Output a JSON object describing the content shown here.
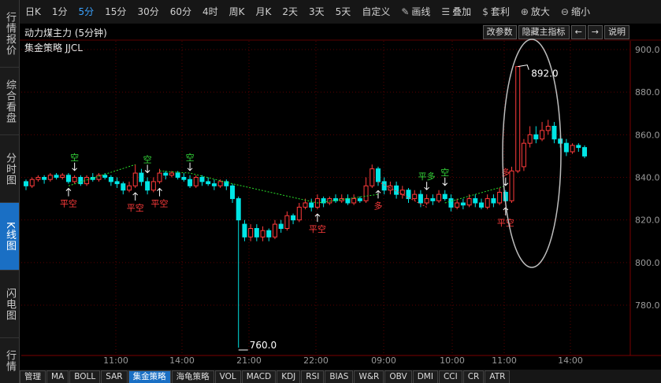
{
  "sidebar": {
    "tabs": [
      {
        "label": "行情报价"
      },
      {
        "label": "综合看盘"
      },
      {
        "label": "分时图"
      },
      {
        "label": "K线图"
      },
      {
        "label": "闪电图"
      },
      {
        "label": "行情"
      }
    ]
  },
  "toolbar": {
    "periods": [
      "日K",
      "1分",
      "5分",
      "15分",
      "30分",
      "60分",
      "4时",
      "周K",
      "月K",
      "2天",
      "3天",
      "5天",
      "自定义"
    ],
    "active_period": "5分",
    "tools": [
      {
        "label": "画线",
        "icon": "pencil-icon"
      },
      {
        "label": "叠加",
        "icon": "layers-icon"
      },
      {
        "label": "套利",
        "icon": "money-bag-icon"
      },
      {
        "label": "放大",
        "icon": "zoom-in-icon"
      },
      {
        "label": "缩小",
        "icon": "zoom-out-icon"
      }
    ]
  },
  "chart_header": {
    "title": "动力煤主力 (5分钟)",
    "buttons": {
      "params": "改参数",
      "hide_main": "隐藏主指标",
      "left": "←",
      "right": "→",
      "help": "说明"
    },
    "indicator": "集金策略 JJCL"
  },
  "colors": {
    "up": "#ff3b3b",
    "down": "#00e5e5",
    "signal_line": "#2adf2a",
    "grid": "#5a0000",
    "accent": "#1a6fc4"
  },
  "chart_data": {
    "type": "candlestick",
    "ylim": [
      765,
      905
    ],
    "y_ticks": [
      "900.0",
      "880.0",
      "860.0",
      "840.0",
      "820.0",
      "800.0",
      "780.0"
    ],
    "x_ticks": [
      "11:00",
      "14:00",
      "21:00",
      "22:00",
      "09:00",
      "10:00",
      "11:00",
      "14:00"
    ],
    "annotations": [
      {
        "text": "892.0",
        "value": 892.0
      },
      {
        "text": "760.0",
        "value": 760.0
      }
    ],
    "candles": [
      [
        838,
        836,
        839,
        834
      ],
      [
        836,
        839,
        840,
        835
      ],
      [
        839,
        840,
        841,
        838
      ],
      [
        840,
        839,
        841,
        837
      ],
      [
        839,
        841,
        842,
        838
      ],
      [
        841,
        840,
        842,
        839
      ],
      [
        840,
        841,
        842,
        839
      ],
      [
        841,
        838,
        842,
        837
      ],
      [
        838,
        840,
        841,
        837
      ],
      [
        840,
        837,
        841,
        836
      ],
      [
        837,
        840,
        841,
        836
      ],
      [
        840,
        839,
        842,
        838
      ],
      [
        839,
        841,
        842,
        838
      ],
      [
        841,
        840,
        842,
        839
      ],
      [
        840,
        838,
        841,
        836
      ],
      [
        838,
        837,
        840,
        835
      ],
      [
        837,
        834,
        838,
        832
      ],
      [
        834,
        836,
        838,
        833
      ],
      [
        836,
        842,
        846,
        835
      ],
      [
        842,
        838,
        844,
        836
      ],
      [
        838,
        834,
        840,
        832
      ],
      [
        834,
        838,
        840,
        833
      ],
      [
        838,
        842,
        844,
        837
      ],
      [
        842,
        841,
        843,
        839
      ],
      [
        841,
        842,
        843,
        840
      ],
      [
        842,
        840,
        843,
        839
      ],
      [
        840,
        839,
        842,
        838
      ],
      [
        839,
        836,
        841,
        835
      ],
      [
        836,
        840,
        841,
        835
      ],
      [
        840,
        838,
        841,
        836
      ],
      [
        838,
        837,
        840,
        836
      ],
      [
        837,
        836,
        839,
        834
      ],
      [
        836,
        838,
        839,
        835
      ],
      [
        838,
        836,
        839,
        834
      ],
      [
        836,
        830,
        837,
        828
      ],
      [
        830,
        820,
        831,
        760
      ],
      [
        818,
        812,
        820,
        810
      ],
      [
        812,
        816,
        818,
        810
      ],
      [
        816,
        812,
        818,
        810
      ],
      [
        812,
        815,
        817,
        810
      ],
      [
        815,
        812,
        816,
        810
      ],
      [
        812,
        818,
        820,
        811
      ],
      [
        818,
        816,
        820,
        814
      ],
      [
        816,
        822,
        824,
        815
      ],
      [
        822,
        820,
        823,
        818
      ],
      [
        820,
        826,
        828,
        819
      ],
      [
        826,
        828,
        830,
        825
      ],
      [
        828,
        826,
        830,
        824
      ],
      [
        826,
        830,
        832,
        825
      ],
      [
        830,
        828,
        831,
        826
      ],
      [
        828,
        830,
        831,
        827
      ],
      [
        830,
        829,
        832,
        828
      ],
      [
        829,
        830,
        832,
        828
      ],
      [
        830,
        828,
        832,
        827
      ],
      [
        828,
        830,
        832,
        827
      ],
      [
        830,
        829,
        831,
        828
      ],
      [
        829,
        836,
        840,
        828
      ],
      [
        836,
        844,
        846,
        835
      ],
      [
        844,
        838,
        845,
        836
      ],
      [
        838,
        834,
        840,
        832
      ],
      [
        834,
        836,
        838,
        832
      ],
      [
        836,
        832,
        838,
        830
      ],
      [
        832,
        834,
        836,
        830
      ],
      [
        834,
        830,
        835,
        828
      ],
      [
        830,
        832,
        834,
        829
      ],
      [
        832,
        828,
        834,
        826
      ],
      [
        828,
        830,
        832,
        827
      ],
      [
        830,
        829,
        832,
        827
      ],
      [
        829,
        832,
        834,
        828
      ],
      [
        832,
        830,
        834,
        829
      ],
      [
        830,
        826,
        832,
        824
      ],
      [
        826,
        828,
        830,
        825
      ],
      [
        828,
        827,
        830,
        825
      ],
      [
        827,
        830,
        832,
        826
      ],
      [
        830,
        828,
        832,
        826
      ],
      [
        828,
        826,
        830,
        825
      ],
      [
        826,
        830,
        832,
        825
      ],
      [
        830,
        828,
        832,
        826
      ],
      [
        828,
        833,
        835,
        827
      ],
      [
        833,
        829,
        834,
        828
      ],
      [
        829,
        843,
        845,
        828
      ],
      [
        843,
        892,
        892,
        842
      ],
      [
        845,
        856,
        858,
        843
      ],
      [
        856,
        860,
        864,
        854
      ],
      [
        860,
        858,
        864,
        856
      ],
      [
        858,
        862,
        866,
        857
      ],
      [
        862,
        864,
        867,
        860
      ],
      [
        864,
        858,
        866,
        856
      ],
      [
        858,
        856,
        860,
        854
      ],
      [
        856,
        852,
        858,
        850
      ],
      [
        852,
        855,
        856,
        851
      ],
      [
        855,
        854,
        856,
        852
      ],
      [
        854,
        850,
        855,
        849
      ]
    ],
    "signals": [
      {
        "label": "平空",
        "color": "red",
        "candle": 7,
        "pos": "below"
      },
      {
        "label": "空",
        "color": "green",
        "candle": 8,
        "pos": "above"
      },
      {
        "label": "平空",
        "color": "red",
        "candle": 18,
        "pos": "below"
      },
      {
        "label": "空",
        "color": "green",
        "candle": 20,
        "pos": "above"
      },
      {
        "label": "平空",
        "color": "red",
        "candle": 22,
        "pos": "below"
      },
      {
        "label": "空",
        "color": "green",
        "candle": 27,
        "pos": "above"
      },
      {
        "label": "平空",
        "color": "red",
        "candle": 48,
        "pos": "below"
      },
      {
        "label": "多",
        "color": "red",
        "candle": 58,
        "pos": "below"
      },
      {
        "label": "平多",
        "color": "green",
        "candle": 66,
        "pos": "above"
      },
      {
        "label": "空",
        "color": "green",
        "candle": 69,
        "pos": "above"
      },
      {
        "label": "平空",
        "color": "red",
        "candle": 79,
        "pos": "below"
      },
      {
        "label": "多",
        "color": "red",
        "candle": 79,
        "pos": "above"
      }
    ]
  },
  "bottom_tabs": [
    "管理",
    "MA",
    "BOLL",
    "SAR",
    "集金策略",
    "海龟策略",
    "VOL",
    "MACD",
    "KDJ",
    "RSI",
    "BIAS",
    "W&R",
    "OBV",
    "DMI",
    "CCI",
    "CR",
    "ATR"
  ],
  "bottom_active": "集金策略"
}
